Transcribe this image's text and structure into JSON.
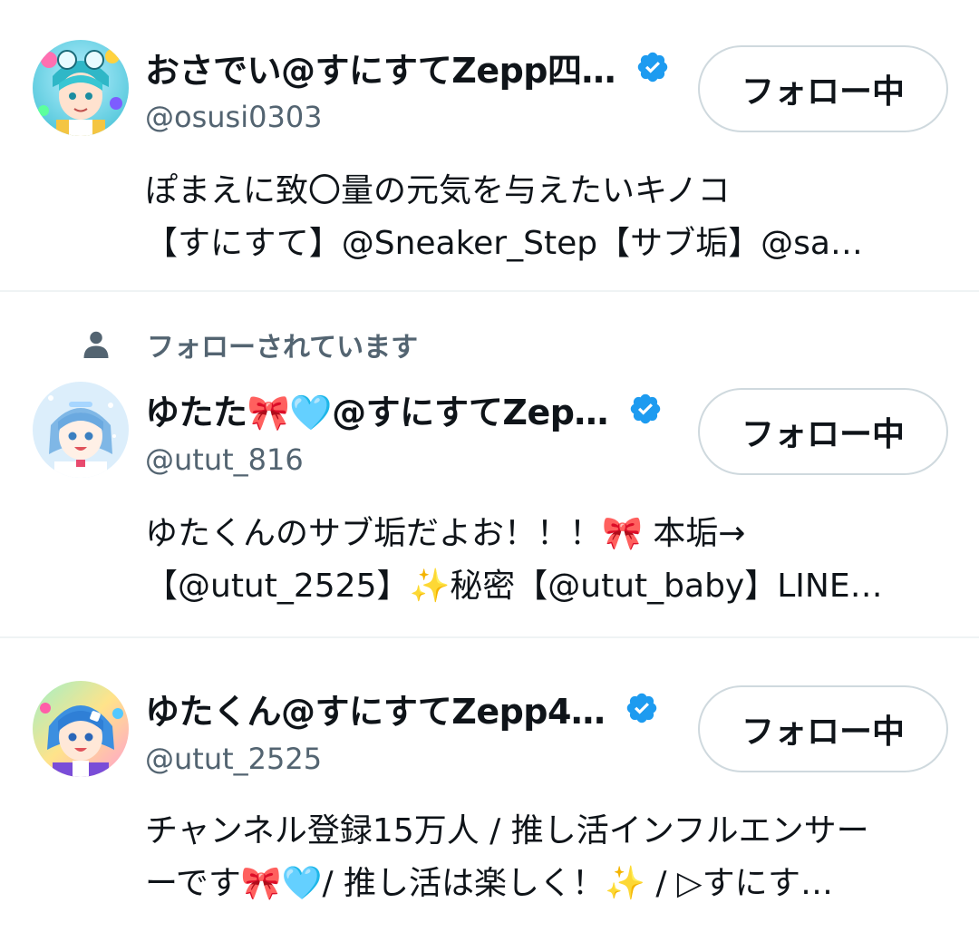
{
  "colors": {
    "text_primary": "#0f1419",
    "text_secondary": "#536471",
    "verified_blue": "#1d9bf0",
    "divider": "#eff3f4",
    "button_border": "#cfd9de"
  },
  "users": [
    {
      "display_name": "おさでい@すにすてZepp四…",
      "handle": "@osusi0303",
      "verified": true,
      "follow_label": "フォロー中",
      "bio_lines": [
        "ぽまえに致〇量の元気を与えたいキノコ",
        "【すにすて】@Sneaker_Step【サブ垢】@sa…"
      ],
      "avatar_icon": "avatar-image"
    },
    {
      "context_label": "フォローされています",
      "context_icon": "person-icon",
      "display_name": "ゆたた🎀🩵@すにすてZep…",
      "handle": "@utut_816",
      "verified": true,
      "follow_label": "フォロー中",
      "bio_lines": [
        "ゆたくんのサブ垢だよお！！！🎀 本垢→",
        "【@utut_2525】✨秘密【@utut_baby】LINE…"
      ],
      "avatar_icon": "avatar-image"
    },
    {
      "display_name": "ゆたくん@すにすてZepp4…",
      "handle": "@utut_2525",
      "verified": true,
      "follow_label": "フォロー中",
      "bio_lines": [
        "チャンネル登録15万人 / 推し活インフルエンサー",
        "ーです🎀🩵/ 推し活は楽しく！✨ / ▷すにす…"
      ],
      "avatar_icon": "avatar-image"
    }
  ]
}
